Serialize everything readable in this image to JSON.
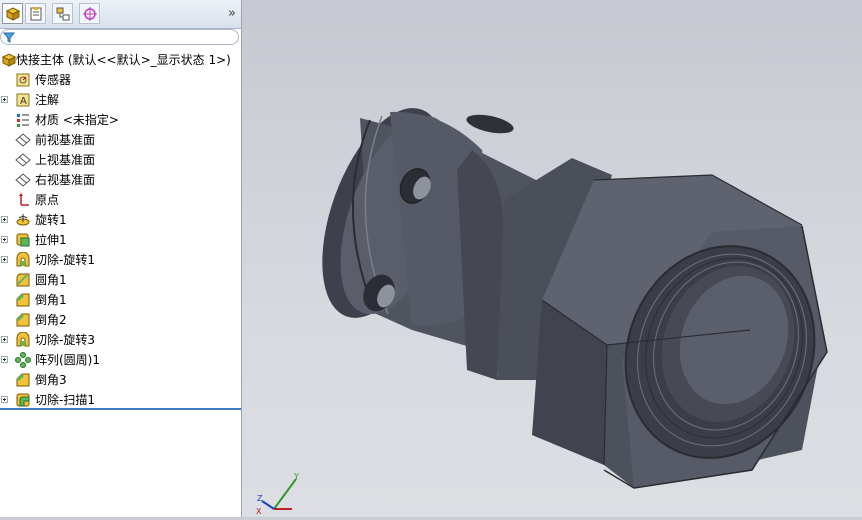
{
  "panel": {
    "more_label": "»",
    "tabs": [
      {
        "name": "featuremanager-tab",
        "icon": "feature-tree-icon"
      },
      {
        "name": "propertymanager-tab",
        "icon": "property-icon"
      },
      {
        "name": "configuration-tab",
        "icon": "configuration-icon"
      },
      {
        "name": "dimxpert-tab",
        "icon": "crosshair-icon"
      }
    ],
    "filter_icon": "filter-icon"
  },
  "tree": {
    "root": "快接主体 (默认<<默认>_显示状态 1>)",
    "items": [
      {
        "label": "传感器",
        "icon": "sensor-icon",
        "expandable": false
      },
      {
        "label": "注解",
        "icon": "annotation-icon",
        "expandable": true
      },
      {
        "label": "材质 <未指定>",
        "icon": "material-icon",
        "expandable": false
      },
      {
        "label": "前视基准面",
        "icon": "plane-icon",
        "expandable": false
      },
      {
        "label": "上视基准面",
        "icon": "plane-icon",
        "expandable": false
      },
      {
        "label": "右视基准面",
        "icon": "plane-icon",
        "expandable": false
      },
      {
        "label": "原点",
        "icon": "origin-icon",
        "expandable": false
      },
      {
        "label": "旋转1",
        "icon": "revolve-icon",
        "expandable": true
      },
      {
        "label": "拉伸1",
        "icon": "extrude-icon",
        "expandable": true
      },
      {
        "label": "切除-旋转1",
        "icon": "cut-revolve-icon",
        "expandable": true
      },
      {
        "label": "圆角1",
        "icon": "fillet-icon",
        "expandable": false
      },
      {
        "label": "倒角1",
        "icon": "chamfer-icon",
        "expandable": false
      },
      {
        "label": "倒角2",
        "icon": "chamfer-icon",
        "expandable": false
      },
      {
        "label": "切除-旋转3",
        "icon": "cut-revolve-icon",
        "expandable": true
      },
      {
        "label": "阵列(圆周)1",
        "icon": "circular-pattern-icon",
        "expandable": true
      },
      {
        "label": "倒角3",
        "icon": "chamfer-icon",
        "expandable": false
      },
      {
        "label": "切除-扫描1",
        "icon": "cut-sweep-icon",
        "expandable": true
      }
    ]
  },
  "triad": {
    "x": "X",
    "y": "Y",
    "z": "Z"
  },
  "colors": {
    "model": "#4f5360",
    "model_dark": "#3a3d47",
    "model_light": "#6e7280",
    "viewport": "#cfd2d8",
    "accent": "#3a7fc6"
  }
}
